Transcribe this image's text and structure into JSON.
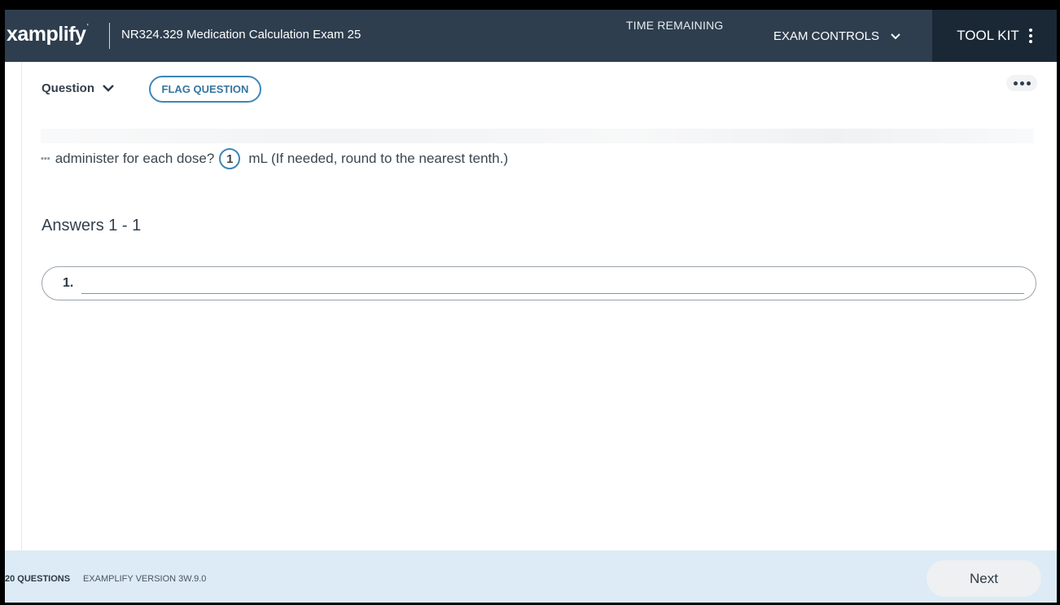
{
  "header": {
    "logo_text": "xamplify",
    "logo_mark": "'",
    "exam_title": "NR324.329 Medication Calculation Exam 25",
    "time_remaining_label": "TIME REMAINING",
    "exam_controls_label": "EXAM CONTROLS",
    "toolkit_label": "TOOL KIT"
  },
  "question_bar": {
    "question_label": "Question",
    "flag_label": "FLAG QUESTION"
  },
  "question": {
    "text_before": "administer for each dose?",
    "blank_number": "1",
    "text_after": "mL (If needed, round to the nearest tenth.)"
  },
  "answers": {
    "heading": "Answers 1 - 1",
    "items": [
      {
        "label": "1.",
        "value": ""
      }
    ]
  },
  "footer": {
    "question_count": "20 QUESTIONS",
    "version": "EXAMPLIFY VERSION 3W.9.0",
    "next_label": "Next"
  },
  "colors": {
    "header_bg": "#2e3e4e",
    "toolkit_bg": "#1a2836",
    "accent": "#3f86b5",
    "footer_bg": "#dcebf5"
  }
}
